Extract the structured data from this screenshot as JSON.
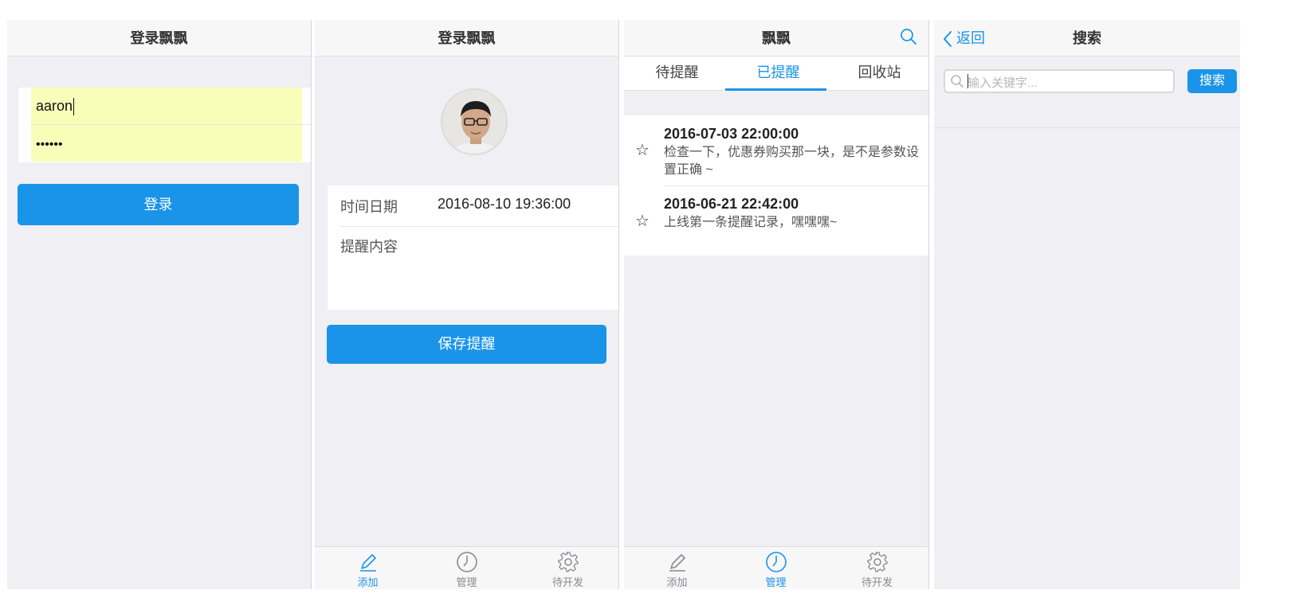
{
  "login": {
    "title": "登录飘飘",
    "username_value": "aaron",
    "password_dots": "••••••",
    "login_button": "登录"
  },
  "add_reminder": {
    "title": "登录飘飘",
    "datetime_label": "时间日期",
    "datetime_value": "2016-08-10 19:36:00",
    "content_label": "提醒内容",
    "save_button": "保存提醒",
    "tabs": [
      {
        "label": "添加",
        "icon": "pencil-icon",
        "active": true
      },
      {
        "label": "管理",
        "icon": "clock-icon",
        "active": false
      },
      {
        "label": "待开发",
        "icon": "gear-icon",
        "active": false
      }
    ]
  },
  "manage": {
    "title": "飘飘",
    "segments": [
      {
        "label": "待提醒",
        "active": false
      },
      {
        "label": "已提醒",
        "active": true
      },
      {
        "label": "回收站",
        "active": false
      }
    ],
    "items": [
      {
        "time": "2016-07-03 22:00:00",
        "text": "检查一下，优惠券购买那一块，是不是参数设置正确 ~",
        "icon": "star-outline-icon"
      },
      {
        "time": "2016-06-21 22:42:00",
        "text": "上线第一条提醒记录，嘿嘿嘿~",
        "icon": "star-outline-icon"
      }
    ],
    "tabs": [
      {
        "label": "添加",
        "icon": "pencil-icon",
        "active": false
      },
      {
        "label": "管理",
        "icon": "clock-icon",
        "active": true
      },
      {
        "label": "待开发",
        "icon": "gear-icon",
        "active": false
      }
    ]
  },
  "search": {
    "back_label": "返回",
    "title": "搜索",
    "placeholder": "输入关键字...",
    "search_button": "搜索"
  },
  "colors": {
    "accent": "#1a94e8",
    "autofill": "#f9fdb8",
    "background": "#efeff4"
  }
}
